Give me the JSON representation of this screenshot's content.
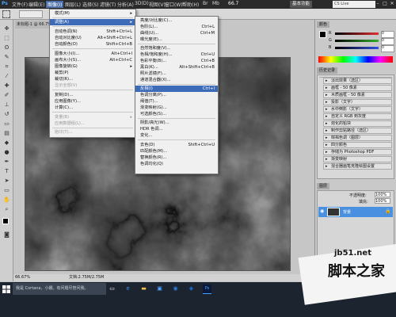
{
  "menubar": {
    "ps_logo": "Ps",
    "items": [
      "文件(F)",
      "编辑(E)",
      "图像(I)",
      "图层(L)",
      "选择(S)",
      "滤镜(T)",
      "分析(A)",
      "3D(D)",
      "视图(V)",
      "窗口(W)",
      "帮助(H)"
    ],
    "active_index": 2,
    "zoom_value": "66.7",
    "essentials_button": "基本功能",
    "search_placeholder": "CS Live"
  },
  "document": {
    "tab_label": "未标题-1 @ 66.7%",
    "zoom_status": "66.67%",
    "doc_info": "文档:2.75M/2.75M"
  },
  "image_menu": {
    "items": [
      {
        "label": "模式(M)",
        "shortcut": "",
        "arrow": true,
        "disabled": false
      },
      {
        "label": "调整(A)",
        "shortcut": "",
        "arrow": true,
        "disabled": false,
        "highlight": true
      },
      {
        "label": "自动色调(N)",
        "shortcut": "Shift+Ctrl+L",
        "disabled": false
      },
      {
        "label": "自动对比度(U)",
        "shortcut": "Alt+Shift+Ctrl+L",
        "disabled": false
      },
      {
        "label": "自动颜色(O)",
        "shortcut": "Shift+Ctrl+B",
        "disabled": false
      },
      {
        "label": "图像大小(I)...",
        "shortcut": "Alt+Ctrl+I",
        "disabled": false
      },
      {
        "label": "画布大小(S)...",
        "shortcut": "Alt+Ctrl+C",
        "disabled": false
      },
      {
        "label": "图像旋转(G)",
        "shortcut": "",
        "arrow": true,
        "disabled": false
      },
      {
        "label": "裁剪(P)",
        "shortcut": "",
        "disabled": false
      },
      {
        "label": "裁切(R)...",
        "shortcut": "",
        "disabled": false
      },
      {
        "label": "显示全部(V)",
        "shortcut": "",
        "disabled": true
      },
      {
        "label": "复制(D)...",
        "shortcut": "",
        "disabled": false
      },
      {
        "label": "应用图像(Y)...",
        "shortcut": "",
        "disabled": false
      },
      {
        "label": "计算(C)...",
        "shortcut": "",
        "disabled": false
      },
      {
        "label": "变量(B)",
        "shortcut": "",
        "arrow": true,
        "disabled": true
      },
      {
        "label": "应用数据组(L)...",
        "shortcut": "",
        "disabled": true
      },
      {
        "label": "陷印(T)...",
        "shortcut": "",
        "disabled": true
      }
    ]
  },
  "adjust_menu": {
    "items": [
      {
        "label": "亮度/对比度(C)...",
        "shortcut": ""
      },
      {
        "label": "色阶(L)...",
        "shortcut": "Ctrl+L"
      },
      {
        "label": "曲线(U)...",
        "shortcut": "Ctrl+M"
      },
      {
        "label": "曝光度(E)...",
        "shortcut": ""
      },
      {
        "label": "自然饱和度(V)...",
        "shortcut": ""
      },
      {
        "label": "色相/饱和度(H)...",
        "shortcut": "Ctrl+U"
      },
      {
        "label": "色彩平衡(B)...",
        "shortcut": "Ctrl+B"
      },
      {
        "label": "黑白(K)...",
        "shortcut": "Alt+Shift+Ctrl+B"
      },
      {
        "label": "照片滤镜(F)...",
        "shortcut": ""
      },
      {
        "label": "通道混合器(X)...",
        "shortcut": ""
      },
      {
        "label": "反相(I)",
        "shortcut": "Ctrl+I",
        "highlight": true
      },
      {
        "label": "色调分离(P)...",
        "shortcut": ""
      },
      {
        "label": "阈值(T)...",
        "shortcut": ""
      },
      {
        "label": "渐变映射(G)...",
        "shortcut": ""
      },
      {
        "label": "可选颜色(S)...",
        "shortcut": ""
      },
      {
        "label": "阴影/高光(W)...",
        "shortcut": ""
      },
      {
        "label": "HDR 色调...",
        "shortcut": ""
      },
      {
        "label": "变化...",
        "shortcut": ""
      },
      {
        "label": "去色(D)",
        "shortcut": "Shift+Ctrl+U"
      },
      {
        "label": "匹配颜色(M)...",
        "shortcut": ""
      },
      {
        "label": "替换颜色(R)...",
        "shortcut": ""
      },
      {
        "label": "色调均化(Q)",
        "shortcut": ""
      }
    ]
  },
  "color_panel": {
    "title": "颜色",
    "rows": [
      {
        "label": "R",
        "value": "0"
      },
      {
        "label": "G",
        "value": "0"
      },
      {
        "label": "B",
        "value": "0"
      }
    ]
  },
  "actions_panel": {
    "title": "历史记录",
    "items": [
      "淡出效果（选区）",
      "画框 - 50 像素",
      "木质画框 - 50 像素",
      "投影（文字）",
      "水中倒影（文字）",
      "自定义 RGB 到灰度",
      "熔化的铅块",
      "制作剪贴路径（选区）",
      "棕褐色调（图层）",
      "四分颜色",
      "存储为 Photoshop PDF",
      "渐变映射",
      "混合器画笔克隆绘图设置"
    ]
  },
  "layers_panel": {
    "title": "图层",
    "opacity_label": "不透明度:",
    "opacity_value": "100%",
    "fill_label": "填充:",
    "fill_value": "100%",
    "layer_name": "背景"
  },
  "taskbar": {
    "cortana_placeholder": "我是 Cortana，小娜。有问题尽管问我。"
  },
  "watermark": {
    "url": "jb51.net",
    "brand": "脚本之家"
  },
  "colors": {
    "menubar_bg": "#2a2a2a",
    "highlight": "#3d6bb8",
    "layer_selected": "#4a90e0",
    "taskbar_bg": "#1c2430",
    "slider_r": "#e03030",
    "slider_g": "#30b030",
    "slider_b": "#3050e0"
  }
}
